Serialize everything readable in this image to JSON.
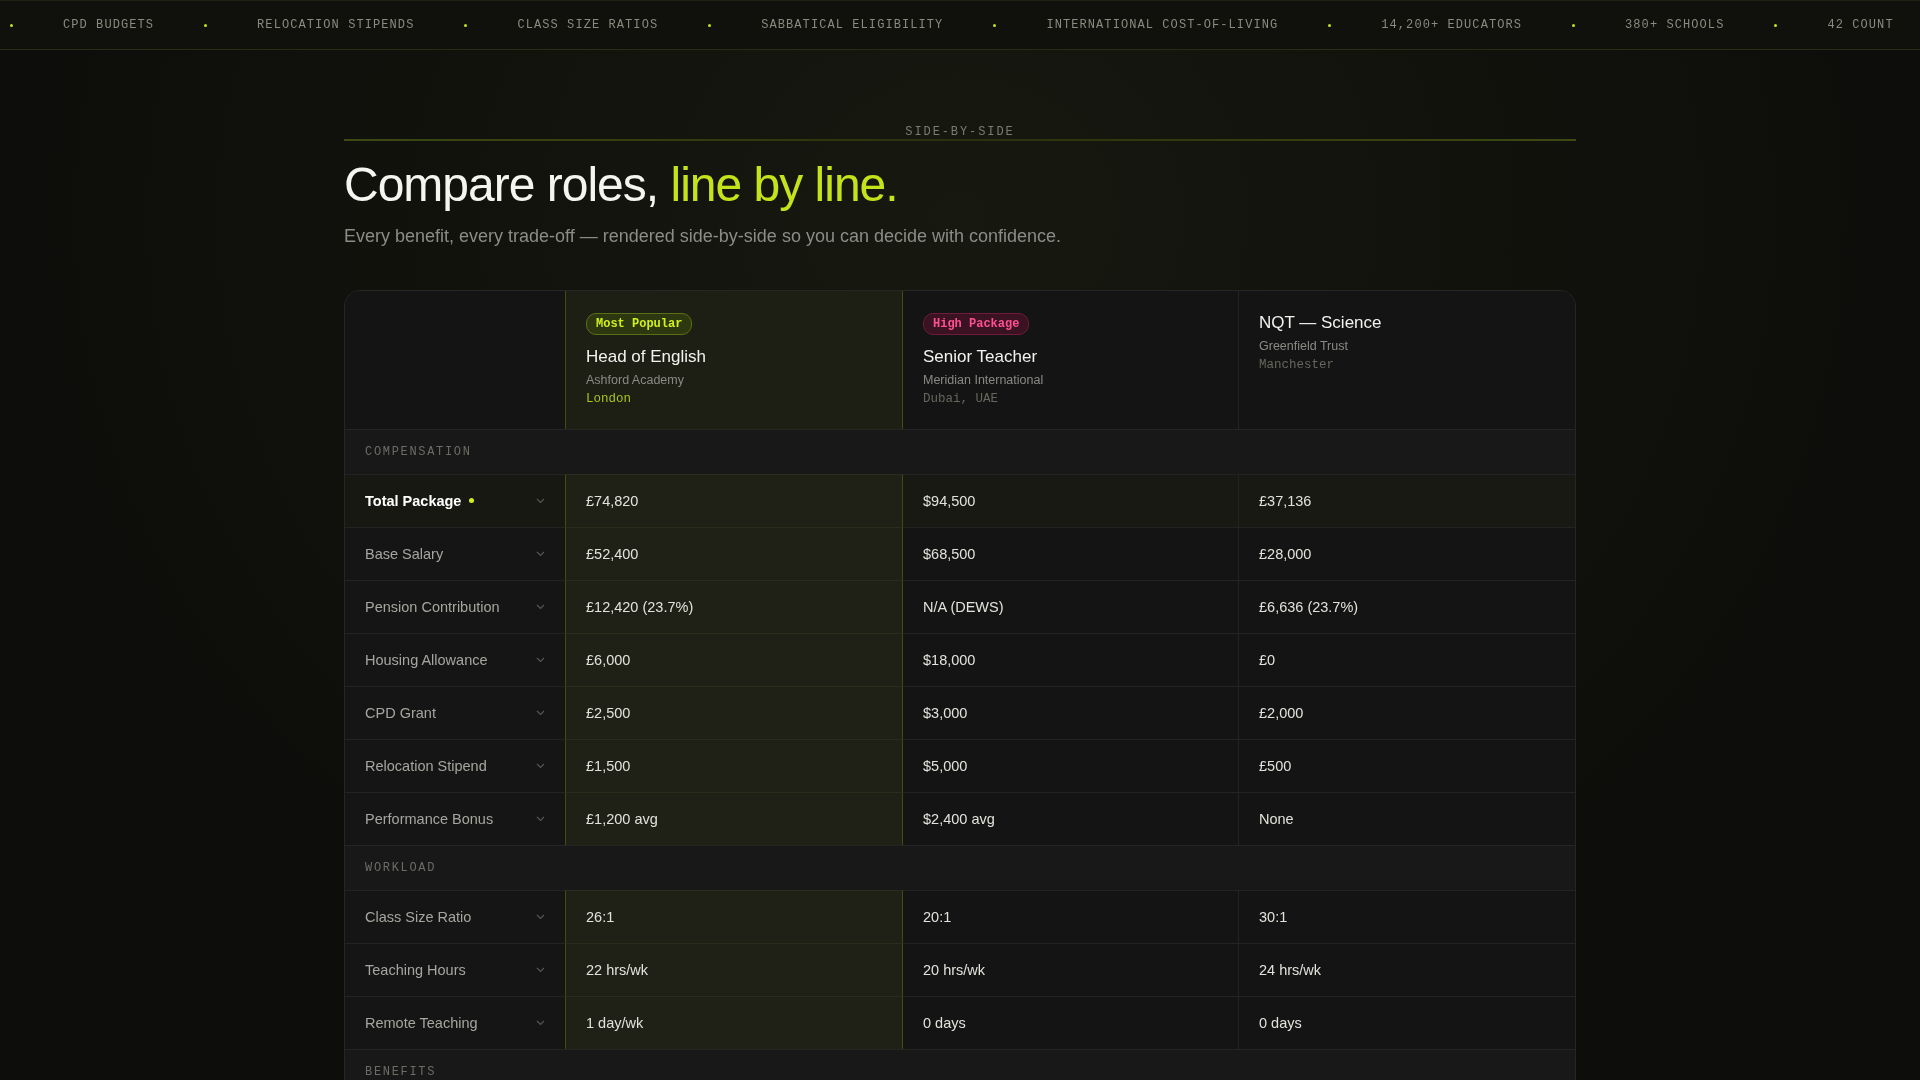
{
  "ticker": [
    "CPD BUDGETS",
    "RELOCATION STIPENDS",
    "CLASS SIZE RATIOS",
    "SABBATICAL ELIGIBILITY",
    "INTERNATIONAL COST-OF-LIVING",
    "14,200+ EDUCATORS",
    "380+ SCHOOLS",
    "42 COUNT"
  ],
  "eyebrow": "SIDE-BY-SIDE",
  "title": {
    "lead": "Compare roles,",
    "accent": "line by line."
  },
  "subtitle": "Every benefit, every trade-off — rendered side-by-side so you can decide with confidence.",
  "roles": [
    {
      "badge": {
        "kind": "popular",
        "label": "Most Popular"
      },
      "title": "Head of English",
      "school": "Ashford Academy",
      "location": "London",
      "featured": true
    },
    {
      "badge": {
        "kind": "high",
        "label": "High Package"
      },
      "title": "Senior Teacher",
      "school": "Meridian International",
      "location": "Dubai, UAE",
      "featured": false
    },
    {
      "title": "NQT — Science",
      "school": "Greenfield Trust",
      "location": "Manchester",
      "featured": false
    }
  ],
  "sections": [
    {
      "title": "COMPENSATION",
      "rows": [
        {
          "label": "Total Package",
          "highlight": true,
          "values": [
            "£74,820",
            "$94,500",
            "£37,136"
          ]
        },
        {
          "label": "Base Salary",
          "highlight": false,
          "values": [
            "£52,400",
            "$68,500",
            "£28,000"
          ]
        },
        {
          "label": "Pension Contribution",
          "highlight": false,
          "values": [
            "£12,420 (23.7%)",
            "N/A (DEWS)",
            "£6,636 (23.7%)"
          ]
        },
        {
          "label": "Housing Allowance",
          "highlight": false,
          "values": [
            "£6,000",
            "$18,000",
            "£0"
          ]
        },
        {
          "label": "CPD Grant",
          "highlight": false,
          "values": [
            "£2,500",
            "$3,000",
            "£2,000"
          ]
        },
        {
          "label": "Relocation Stipend",
          "highlight": false,
          "values": [
            "£1,500",
            "$5,000",
            "£500"
          ]
        },
        {
          "label": "Performance Bonus",
          "highlight": false,
          "values": [
            "£1,200 avg",
            "$2,400 avg",
            "None"
          ]
        }
      ]
    },
    {
      "title": "WORKLOAD",
      "rows": [
        {
          "label": "Class Size Ratio",
          "highlight": false,
          "values": [
            "26:1",
            "20:1",
            "30:1"
          ]
        },
        {
          "label": "Teaching Hours",
          "highlight": false,
          "values": [
            "22 hrs/wk",
            "20 hrs/wk",
            "24 hrs/wk"
          ]
        },
        {
          "label": "Remote Teaching",
          "highlight": false,
          "values": [
            "1 day/wk",
            "0 days",
            "0 days"
          ]
        }
      ]
    },
    {
      "title": "BENEFITS"
    }
  ]
}
